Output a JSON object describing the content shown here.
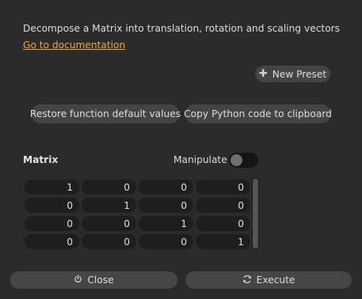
{
  "description": "Decompose a Matrix into translation, rotation and scaling vectors",
  "doc_link": "Go to documentation",
  "presets": {
    "new_preset_label": "New Preset",
    "new_preset_icon": "plus-icon"
  },
  "actions": {
    "restore_label": "Restore function default values",
    "copy_label": "Copy Python code to clipboard"
  },
  "matrix": {
    "label": "Matrix",
    "manipulate_label": "Manipulate",
    "manipulate_on": false,
    "rows": [
      [
        "1",
        "0",
        "0",
        "0"
      ],
      [
        "0",
        "1",
        "0",
        "0"
      ],
      [
        "0",
        "0",
        "1",
        "0"
      ],
      [
        "0",
        "0",
        "0",
        "1"
      ]
    ]
  },
  "footer": {
    "close_label": "Close",
    "close_icon": "power-icon",
    "execute_label": "Execute",
    "execute_icon": "refresh-icon"
  },
  "colors": {
    "background": "#2b2b2b",
    "link": "#f0a830",
    "button": "#444444",
    "cell": "#1e1e1e"
  }
}
